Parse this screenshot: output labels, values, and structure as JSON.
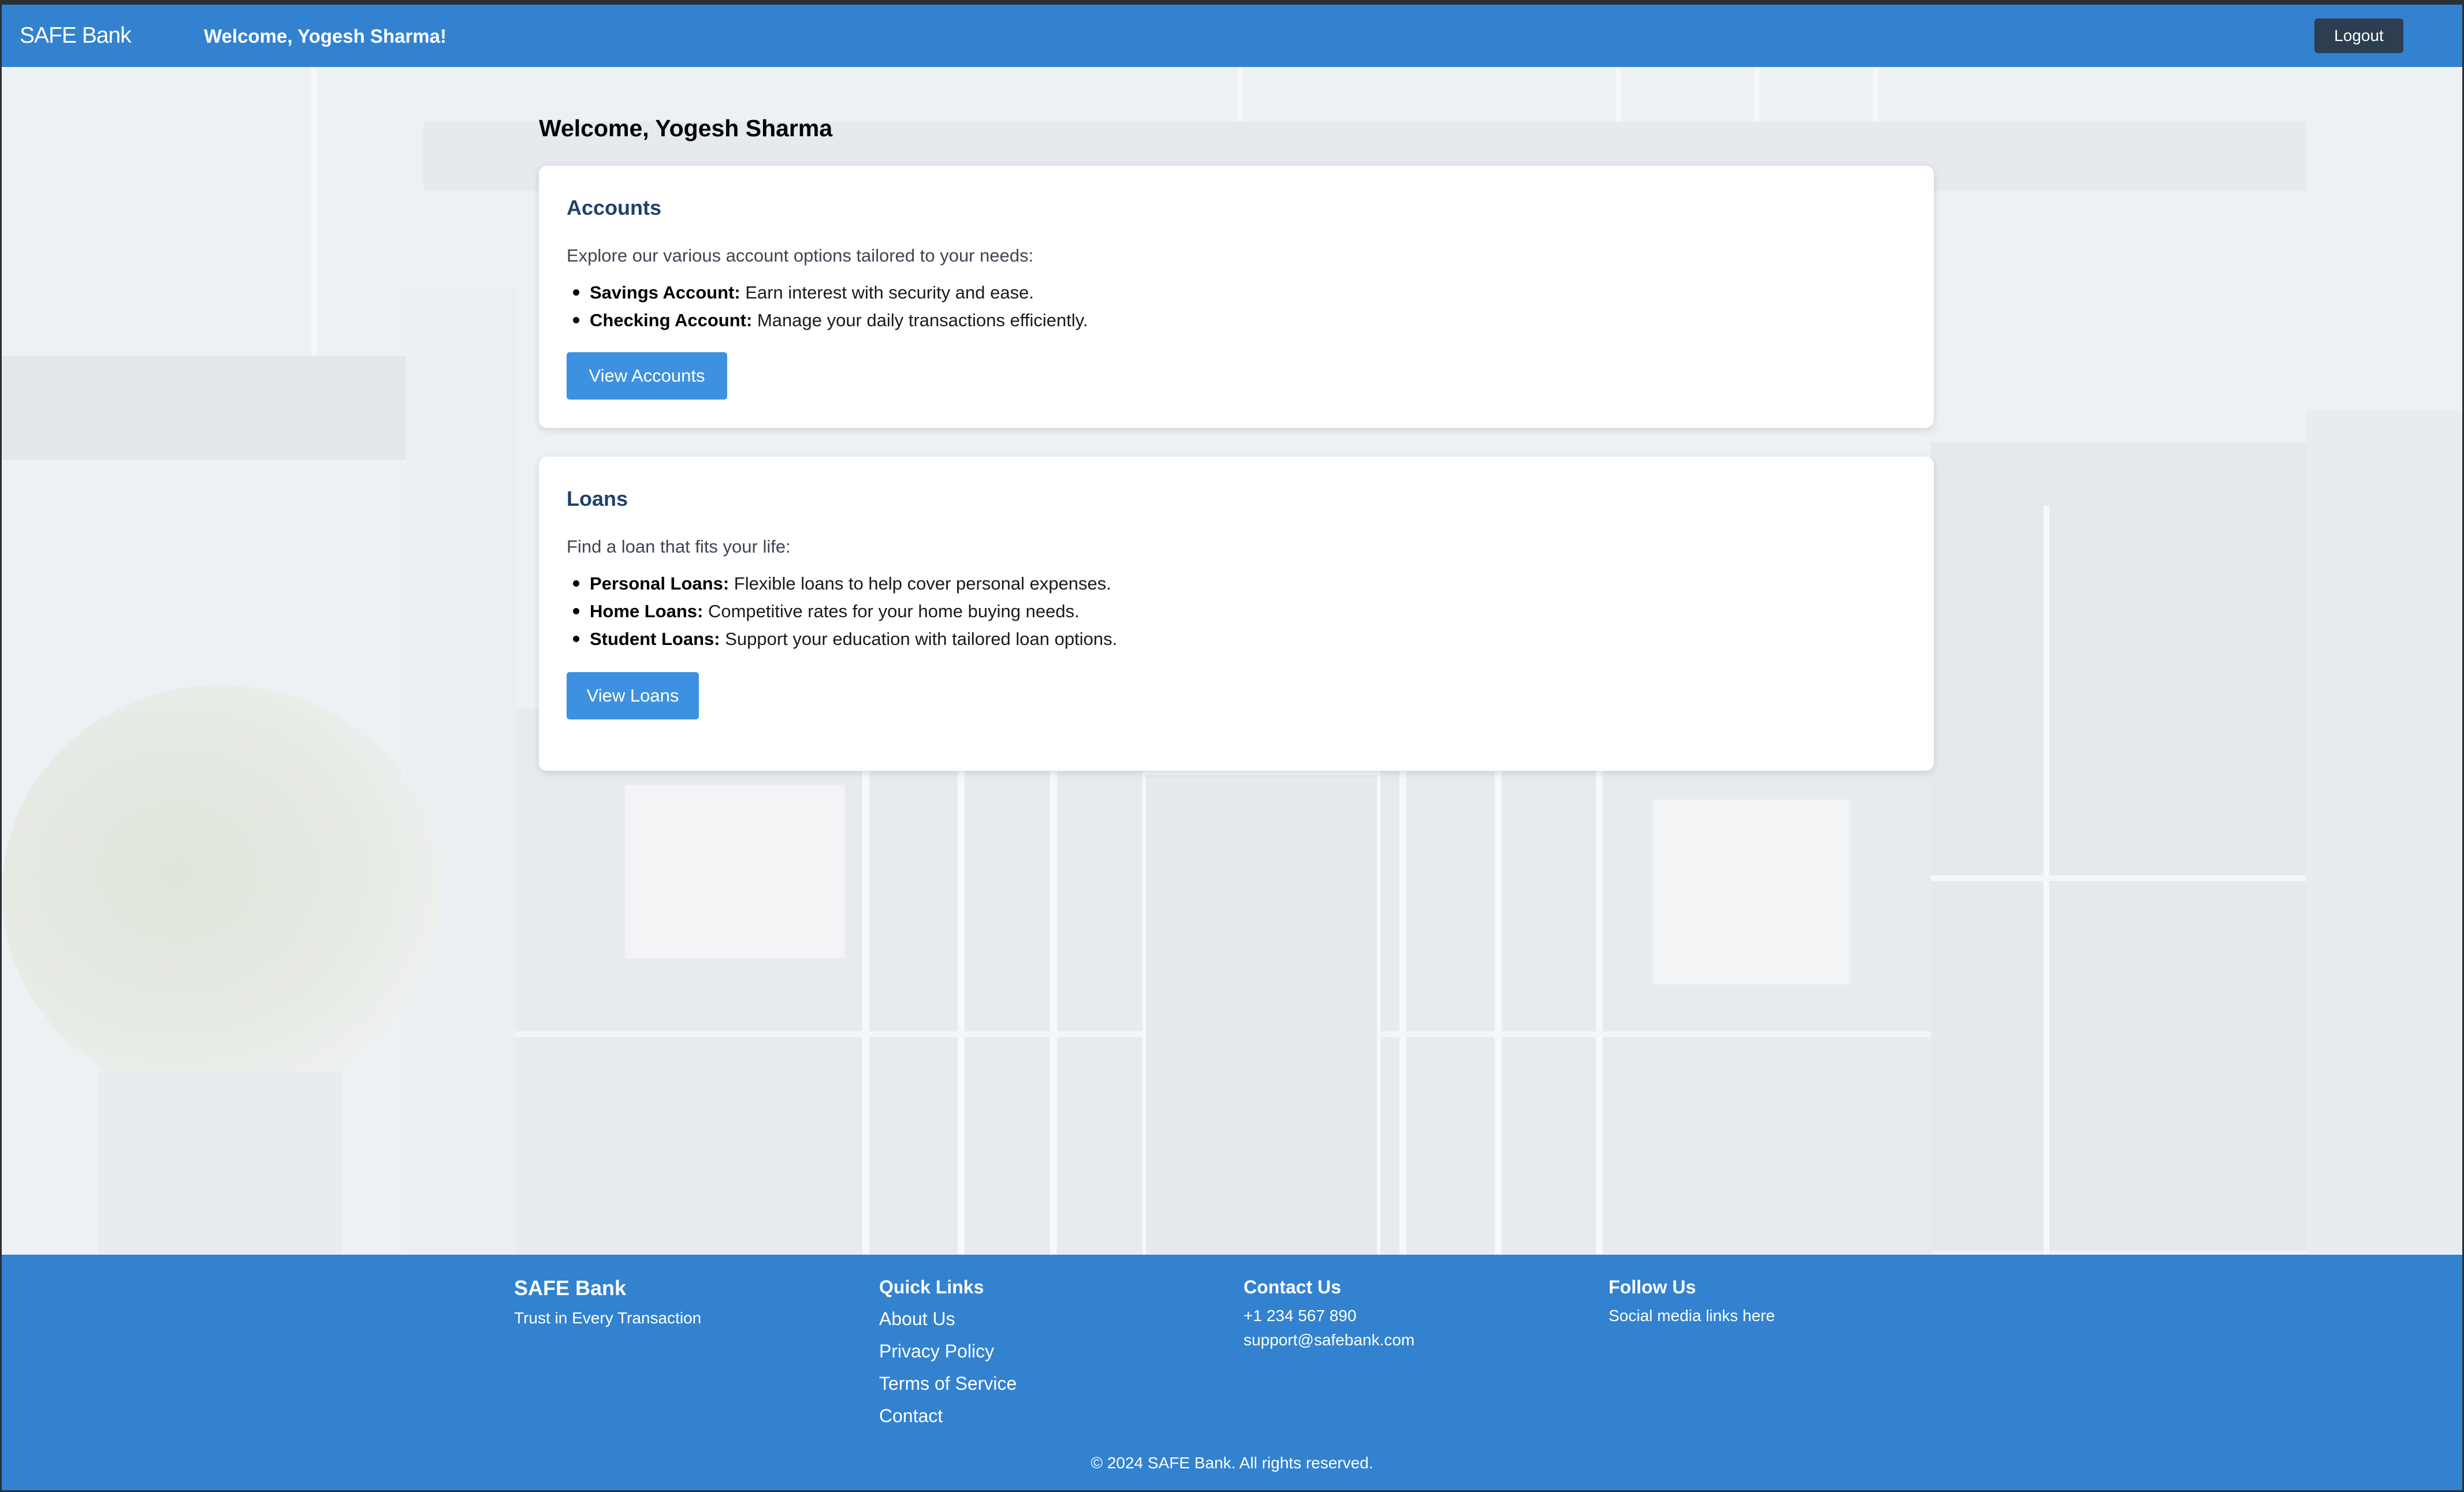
{
  "header": {
    "brand": "SAFE Bank",
    "welcome": "Welcome, Yogesh Sharma!",
    "logout_label": "Logout"
  },
  "main": {
    "title": "Welcome, Yogesh Sharma",
    "cards": [
      {
        "title": "Accounts",
        "intro": "Explore our various account options tailored to your needs:",
        "items": [
          {
            "term": "Savings Account:",
            "desc": " Earn interest with security and ease."
          },
          {
            "term": "Checking Account:",
            "desc": " Manage your daily transactions efficiently."
          }
        ],
        "button_label": "View Accounts"
      },
      {
        "title": "Loans",
        "intro": "Find a loan that fits your life:",
        "items": [
          {
            "term": "Personal Loans:",
            "desc": " Flexible loans to help cover personal expenses."
          },
          {
            "term": "Home Loans:",
            "desc": " Competitive rates for your home buying needs."
          },
          {
            "term": "Student Loans:",
            "desc": " Support your education with tailored loan options."
          }
        ],
        "button_label": "View Loans"
      }
    ]
  },
  "footer": {
    "brand": "SAFE Bank",
    "tagline": "Trust in Every Transaction",
    "quick_links_heading": "Quick Links",
    "quick_links": [
      "About Us",
      "Privacy Policy",
      "Terms of Service",
      "Contact"
    ],
    "contact_heading": "Contact Us",
    "phone": "+1 234 567 890",
    "email": "support@safebank.com",
    "follow_heading": "Follow Us",
    "follow_text": "Social media links here",
    "copyright": "© 2024 SAFE Bank. All rights reserved."
  },
  "colors": {
    "header_bg": "#3282d0",
    "footer_bg": "#3282d0",
    "primary_button": "#3d91e0",
    "logout_button": "#2c3e50",
    "card_title": "#21406b"
  }
}
